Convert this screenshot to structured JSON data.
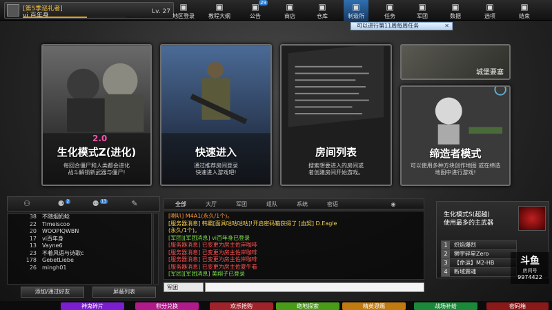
{
  "profile": {
    "season": "[第5季巡礼者]",
    "name": "vi 百年身",
    "level": "Lv. 27",
    "xp_progress": 0.62
  },
  "nav": [
    {
      "label": "地区登录",
      "icon": "map-icon"
    },
    {
      "label": "教程大纲",
      "icon": "book-icon"
    },
    {
      "label": "公告",
      "icon": "megaphone-icon",
      "badge": "29"
    },
    {
      "label": "商店",
      "icon": "tv-icon"
    },
    {
      "label": "仓库",
      "icon": "warehouse-icon"
    },
    {
      "label": "制造所",
      "icon": "car-icon"
    },
    {
      "label": "任务",
      "icon": "task-icon"
    },
    {
      "label": "军团",
      "icon": "flag-icon"
    },
    {
      "label": "数据",
      "icon": "chart-icon"
    },
    {
      "label": "选项",
      "icon": "gear-icon"
    },
    {
      "label": "结束",
      "icon": "power-icon"
    }
  ],
  "task_tip": "可以进行第11周每周任务",
  "cards": [
    {
      "title": "生化模式Z(进化)",
      "badge": "2.0",
      "desc": "每回合僵尸和人类都会进化\n战斗解锁新武器与僵尸!"
    },
    {
      "title": "快速进入",
      "desc": "通过推荐房间登录\n快速进入游戏吧!"
    },
    {
      "title": "房间列表",
      "desc": "搜索想要进入的房间或\n者创建房间开始游戏。"
    },
    {
      "title": "缔造者模式",
      "desc": "可以使用多种方块创作地图\n或在缔造地图中进行游戏!"
    }
  ],
  "small_card": {
    "title": "城堡要塞"
  },
  "friends": {
    "tab_badges": [
      "2",
      "13"
    ],
    "rows": [
      {
        "num": "38",
        "name": "不随烟奶鲶"
      },
      {
        "num": "22",
        "name": "Timeiscoo"
      },
      {
        "num": "20",
        "name": "WOOPIQWBN"
      },
      {
        "num": "17",
        "name": "vi百年身"
      },
      {
        "num": "13",
        "name": "Vayne6"
      },
      {
        "num": "23",
        "name": "不着风语与诗歌c"
      },
      {
        "num": "178",
        "name": "GebetLiebe"
      },
      {
        "num": "26",
        "name": "mingh01"
      }
    ],
    "add_button": "添加/通过好友",
    "block_button": "屏蔽列表",
    "help": "帮助"
  },
  "chat": {
    "tabs": [
      "全部",
      "大厅",
      "军团",
      "组队",
      "系统",
      "密语"
    ],
    "lines": [
      {
        "text": "[喇叭] M4A1(永久/1个)。",
        "color": "c-orange"
      },
      {
        "text": "[服务器消息] 韩霸[面具咕咕咕咕]!开启密码箱获得了 [血契] D.Eagle",
        "color": "c-yellow"
      },
      {
        "text": "(永久/1个)。",
        "color": "c-yellow"
      },
      {
        "text": "[军团][军团消息] vi百年身已登录",
        "color": "c-green"
      },
      {
        "text": "[服务器消息] 已变更为房主佐岸咖啡",
        "color": "c-red"
      },
      {
        "text": "[服务器消息] 已变更为房主佐岸咖啡",
        "color": "c-red"
      },
      {
        "text": "[服务器消息] 已变更为房主佐岸咖啡",
        "color": "c-red"
      },
      {
        "text": "[服务器消息] 已变更为房主佐夏牛看",
        "color": "c-red"
      },
      {
        "text": "[军团][军团消息] 美翔子已登录",
        "color": "c-green"
      }
    ],
    "channel": "军团"
  },
  "mode_panel": {
    "title": "生化模式S(超越)\n使用最多的主武器",
    "rows": [
      {
        "rank": "1",
        "name": "炽焰爆烈"
      },
      {
        "rank": "2",
        "name": "狮宇碎星Zero"
      },
      {
        "rank": "3",
        "name": "【命运】M2-HB"
      },
      {
        "rank": "4",
        "name": "断域震魂"
      }
    ]
  },
  "douyu": {
    "logo": "斗鱼",
    "room_label": "房间号",
    "room_id": "9974422"
  },
  "bottom_buttons": [
    {
      "label": "神鬼碎片",
      "color": "#7a1ed0"
    },
    {
      "label": "积分兑换",
      "color": "#b01a8a"
    },
    {
      "label": "欢乐抢购",
      "color": "#a0222a"
    },
    {
      "label": "绝地探索",
      "color": "#4a9a1a"
    },
    {
      "label": "精英恩赐",
      "color": "#c07a10"
    },
    {
      "label": "战场补给",
      "color": "#1a8a3a"
    },
    {
      "label": "密码箱",
      "color": "#8a1a1a"
    }
  ]
}
